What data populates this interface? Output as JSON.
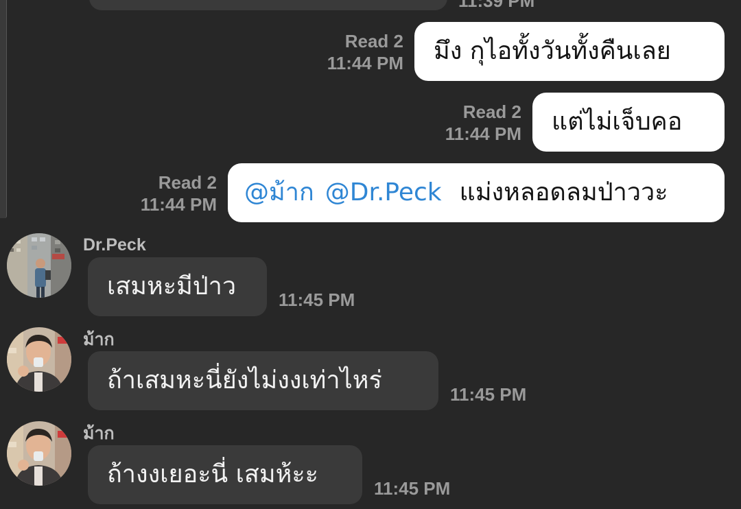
{
  "chat": {
    "top_partial_time": "11:39 PM",
    "outgoing": [
      {
        "read": "Read 2",
        "time": "11:44 PM",
        "text": "มึง กุไอทั้งวันทั้งคืนเลย"
      },
      {
        "read": "Read 2",
        "time": "11:44 PM",
        "text": "แต่ไม่เจ็บคอ"
      },
      {
        "read": "Read 2",
        "time": "11:44 PM",
        "mentions": [
          "@ม้าก",
          "@Dr.Peck"
        ],
        "text": "แม่งหลอดลมป่าววะ"
      }
    ],
    "incoming": [
      {
        "sender": "Dr.Peck",
        "text": "เสมหะมีป่าว",
        "time": "11:45 PM"
      },
      {
        "sender": "ม้าก",
        "text": "ถ้าเสมหะนี่ยังไม่งงเท่าไหร่",
        "time": "11:45 PM"
      },
      {
        "sender": "ม้าก",
        "text": "ถ้างงเยอะนี่ เสมห้ะะ",
        "time": "11:45 PM"
      }
    ]
  },
  "colors": {
    "background": "#272727",
    "outgoing_bubble": "#ffffff",
    "incoming_bubble": "#3a3a3a",
    "mention": "#2f86d4",
    "meta_text": "#9a9a9a"
  },
  "icons": {
    "avatar_drpeck": "avatar-photo-icon",
    "avatar_mak": "avatar-photo-icon"
  }
}
